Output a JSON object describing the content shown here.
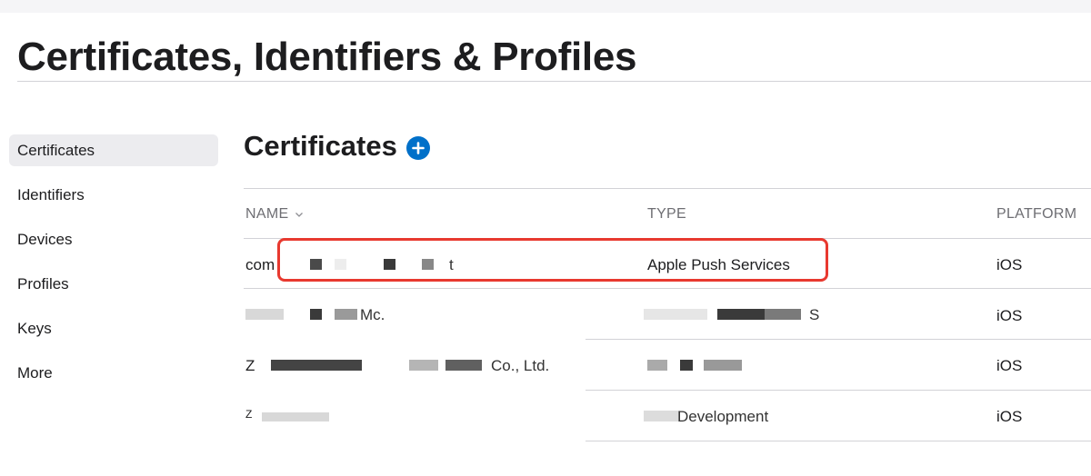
{
  "page": {
    "title": "Certificates, Identifiers & Profiles"
  },
  "sidebar": {
    "items": [
      {
        "label": "Certificates",
        "active": true
      },
      {
        "label": "Identifiers"
      },
      {
        "label": "Devices"
      },
      {
        "label": "Profiles"
      },
      {
        "label": "Keys"
      },
      {
        "label": "More"
      }
    ]
  },
  "main": {
    "section_title": "Certificates",
    "add_icon": "plus-circle-icon",
    "columns": {
      "name": "NAME",
      "type": "TYPE",
      "platform": "PLATFORM"
    },
    "sort_icon": "chevron-down-icon",
    "rows": [
      {
        "name_fragment_start": "com",
        "name_fragment_end": "t",
        "type": "Apple Push Services",
        "platform": "iOS",
        "highlighted": true
      },
      {
        "name_fragment_end": "Mc.",
        "type_fragment_end": "S",
        "platform": "iOS"
      },
      {
        "name_fragment_start": "Z",
        "name_fragment_end": "Co., Ltd.",
        "platform": "iOS"
      },
      {
        "name_fragment_start": "Z",
        "type_fragment_end": "Development",
        "platform": "iOS"
      }
    ]
  },
  "colors": {
    "accent": "#0070c9",
    "highlight": "#e8392f",
    "sidebar_active": "#ececef"
  }
}
